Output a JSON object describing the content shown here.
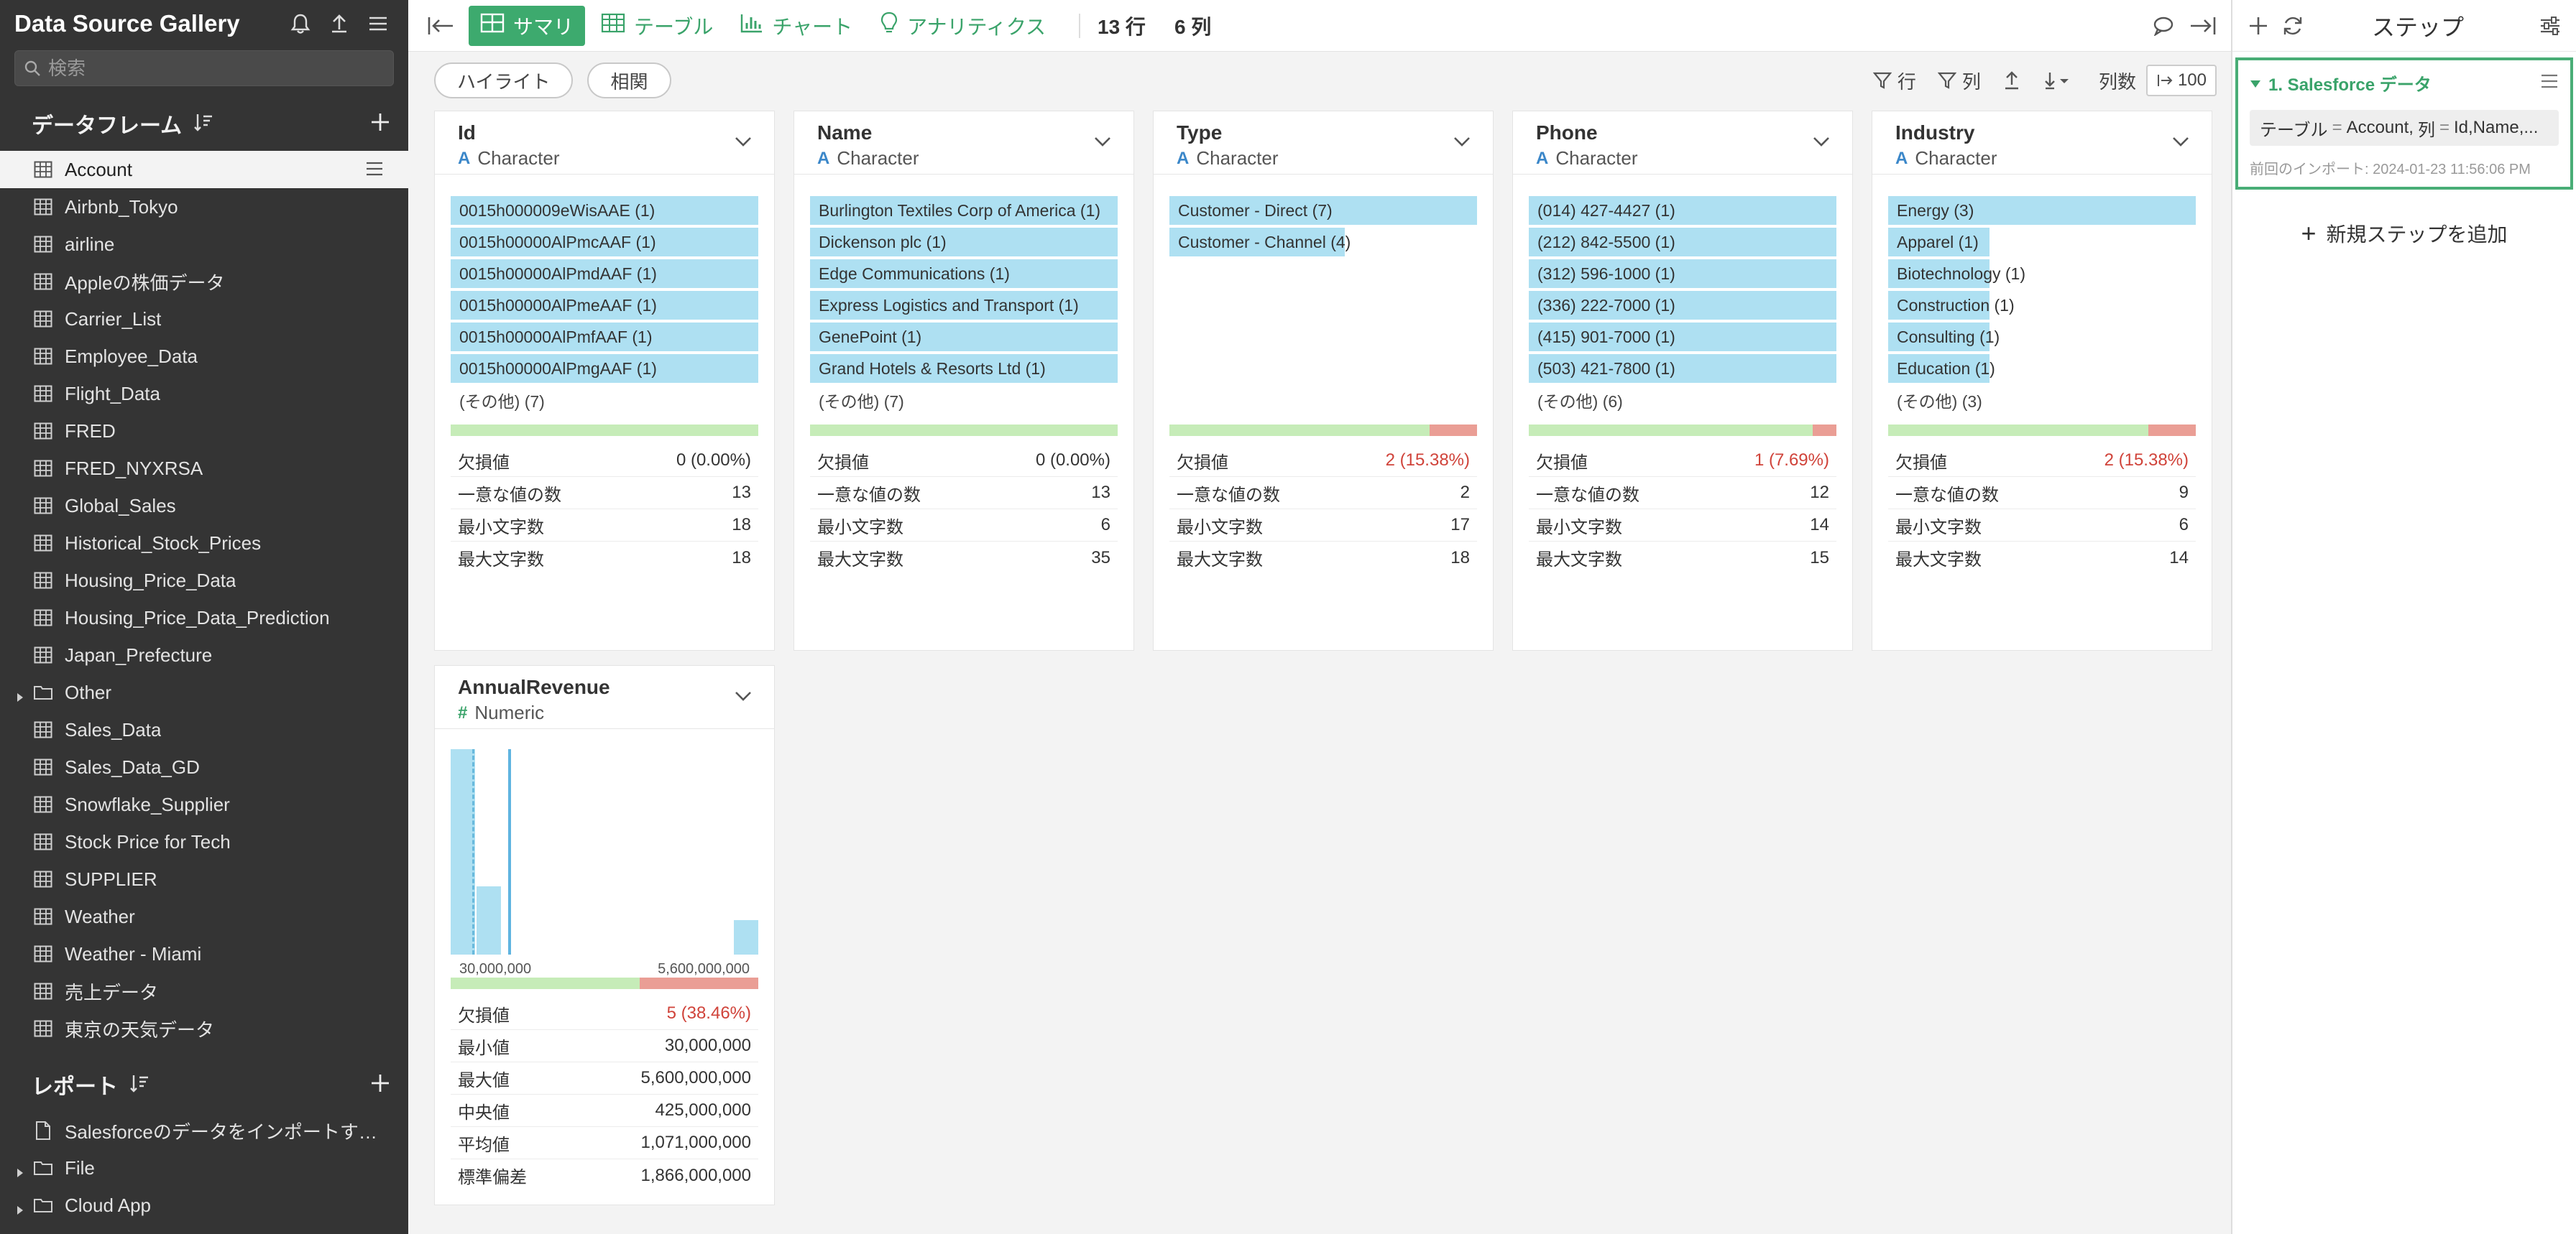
{
  "sidebar": {
    "title": "Data Source Gallery",
    "search_placeholder": "検索",
    "dataframes_title": "データフレーム",
    "dataframes": [
      {
        "label": "Account",
        "active": true
      },
      {
        "label": "Airbnb_Tokyo"
      },
      {
        "label": "airline"
      },
      {
        "label": "Appleの株価データ"
      },
      {
        "label": "Carrier_List"
      },
      {
        "label": "Employee_Data"
      },
      {
        "label": "Flight_Data"
      },
      {
        "label": "FRED"
      },
      {
        "label": "FRED_NYXRSA"
      },
      {
        "label": "Global_Sales"
      },
      {
        "label": "Historical_Stock_Prices"
      },
      {
        "label": "Housing_Price_Data"
      },
      {
        "label": "Housing_Price_Data_Prediction"
      },
      {
        "label": "Japan_Prefecture"
      },
      {
        "label": "Other",
        "folder": true
      },
      {
        "label": "Sales_Data"
      },
      {
        "label": "Sales_Data_GD"
      },
      {
        "label": "Snowflake_Supplier"
      },
      {
        "label": "Stock Price for Tech"
      },
      {
        "label": "SUPPLIER"
      },
      {
        "label": "Weather"
      },
      {
        "label": "Weather - Miami"
      },
      {
        "label": "売上データ"
      },
      {
        "label": "東京の天気データ"
      }
    ],
    "reports_title": "レポート",
    "reports": [
      {
        "label": "Salesforceのデータをインポートす…",
        "icon": "document-icon"
      },
      {
        "label": "File",
        "folder": true
      },
      {
        "label": "Cloud App",
        "folder": true
      }
    ]
  },
  "toolbar": {
    "tabs": [
      {
        "label": "サマリ",
        "icon": "summary-icon",
        "active": true
      },
      {
        "label": "テーブル",
        "icon": "table-icon"
      },
      {
        "label": "チャート",
        "icon": "chart-icon"
      },
      {
        "label": "アナリティクス",
        "icon": "bulb-icon"
      }
    ],
    "rows": "13 行",
    "cols": "6 列"
  },
  "subbar": {
    "highlight": "ハイライト",
    "correlation": "相関",
    "row_filter": "行",
    "col_filter": "列",
    "col_count_label": "列数",
    "col_count_value": "100"
  },
  "columns": [
    {
      "name": "Id",
      "type": "Character",
      "bars": [
        {
          "label": "0015h000009eWisAAE (1)",
          "pct": 100
        },
        {
          "label": "0015h00000AlPmcAAF (1)",
          "pct": 100
        },
        {
          "label": "0015h00000AlPmdAAF (1)",
          "pct": 100
        },
        {
          "label": "0015h00000AlPmeAAF (1)",
          "pct": 100
        },
        {
          "label": "0015h00000AlPmfAAF (1)",
          "pct": 100
        },
        {
          "label": "0015h00000AlPmgAAF (1)",
          "pct": 100
        }
      ],
      "other": "(その他) (7)",
      "missing_pct": 0,
      "stats": [
        {
          "k": "欠損値",
          "v": "0 (0.00%)"
        },
        {
          "k": "一意な値の数",
          "v": "13"
        },
        {
          "k": "最小文字数",
          "v": "18"
        },
        {
          "k": "最大文字数",
          "v": "18"
        }
      ]
    },
    {
      "name": "Name",
      "type": "Character",
      "bars": [
        {
          "label": "Burlington Textiles Corp of America (1)",
          "pct": 100
        },
        {
          "label": "Dickenson plc (1)",
          "pct": 100
        },
        {
          "label": "Edge Communications (1)",
          "pct": 100
        },
        {
          "label": "Express Logistics and Transport (1)",
          "pct": 100
        },
        {
          "label": "GenePoint (1)",
          "pct": 100
        },
        {
          "label": "Grand Hotels & Resorts Ltd (1)",
          "pct": 100
        }
      ],
      "other": "(その他) (7)",
      "missing_pct": 0,
      "stats": [
        {
          "k": "欠損値",
          "v": "0 (0.00%)"
        },
        {
          "k": "一意な値の数",
          "v": "13"
        },
        {
          "k": "最小文字数",
          "v": "6"
        },
        {
          "k": "最大文字数",
          "v": "35"
        }
      ]
    },
    {
      "name": "Type",
      "type": "Character",
      "bars": [
        {
          "label": "Customer - Direct (7)",
          "pct": 100
        },
        {
          "label": "Customer - Channel (4)",
          "pct": 57
        }
      ],
      "other": "",
      "missing_pct": 15.38,
      "stats": [
        {
          "k": "欠損値",
          "v": "2 (15.38%)",
          "red": true
        },
        {
          "k": "一意な値の数",
          "v": "2"
        },
        {
          "k": "最小文字数",
          "v": "17"
        },
        {
          "k": "最大文字数",
          "v": "18"
        }
      ]
    },
    {
      "name": "Phone",
      "type": "Character",
      "bars": [
        {
          "label": "(014) 427-4427 (1)",
          "pct": 100
        },
        {
          "label": "(212) 842-5500 (1)",
          "pct": 100
        },
        {
          "label": "(312) 596-1000 (1)",
          "pct": 100
        },
        {
          "label": "(336) 222-7000 (1)",
          "pct": 100
        },
        {
          "label": "(415) 901-7000 (1)",
          "pct": 100
        },
        {
          "label": "(503) 421-7800 (1)",
          "pct": 100
        }
      ],
      "other": "(その他) (6)",
      "missing_pct": 7.69,
      "stats": [
        {
          "k": "欠損値",
          "v": "1 (7.69%)",
          "red": true
        },
        {
          "k": "一意な値の数",
          "v": "12"
        },
        {
          "k": "最小文字数",
          "v": "14"
        },
        {
          "k": "最大文字数",
          "v": "15"
        }
      ]
    },
    {
      "name": "Industry",
      "type": "Character",
      "bars": [
        {
          "label": "Energy (3)",
          "pct": 100
        },
        {
          "label": "Apparel (1)",
          "pct": 33
        },
        {
          "label": "Biotechnology (1)",
          "pct": 33
        },
        {
          "label": "Construction (1)",
          "pct": 33
        },
        {
          "label": "Consulting (1)",
          "pct": 33
        },
        {
          "label": "Education (1)",
          "pct": 33
        }
      ],
      "other": "(その他) (3)",
      "missing_pct": 15.38,
      "stats": [
        {
          "k": "欠損値",
          "v": "2 (15.38%)",
          "red": true
        },
        {
          "k": "一意な値の数",
          "v": "9"
        },
        {
          "k": "最小文字数",
          "v": "6"
        },
        {
          "k": "最大文字数",
          "v": "14"
        }
      ]
    }
  ],
  "numeric_column": {
    "name": "AnnualRevenue",
    "type": "Numeric",
    "chart_data": {
      "type": "bar",
      "x_min_label": "30,000,000",
      "x_max_label": "5,600,000,000",
      "bins": [
        6,
        2,
        0,
        0,
        0,
        0,
        0,
        0,
        0,
        0,
        0,
        1
      ],
      "mean_marker": 1071000000,
      "median_marker": 425000000,
      "xlim": [
        30000000,
        5600000000
      ]
    },
    "missing_pct": 38.46,
    "stats": [
      {
        "k": "欠損値",
        "v": "5 (38.46%)",
        "red": true
      },
      {
        "k": "最小値",
        "v": "30,000,000"
      },
      {
        "k": "最大値",
        "v": "5,600,000,000"
      },
      {
        "k": "中央値",
        "v": "425,000,000"
      },
      {
        "k": "平均値",
        "v": "1,071,000,000"
      },
      {
        "k": "標準偏差",
        "v": "1,866,000,000"
      }
    ]
  },
  "steps": {
    "title": "ステップ",
    "step_name": "1. Salesforce データ",
    "param_table_key": "テーブル",
    "param_table_val": "Account,",
    "param_col_key": "列",
    "param_col_val": "Id,Name,...",
    "param_eq": "=",
    "import_time": "前回のインポート: 2024-01-23 11:56:06 PM",
    "add_step": "新規ステップを追加"
  },
  "colors": {
    "accent": "#3daa6e",
    "bar_fill": "#aee0f2",
    "ok": "#c6ecb8",
    "missing": "#ea9e95",
    "sidebar_bg": "#343434"
  }
}
